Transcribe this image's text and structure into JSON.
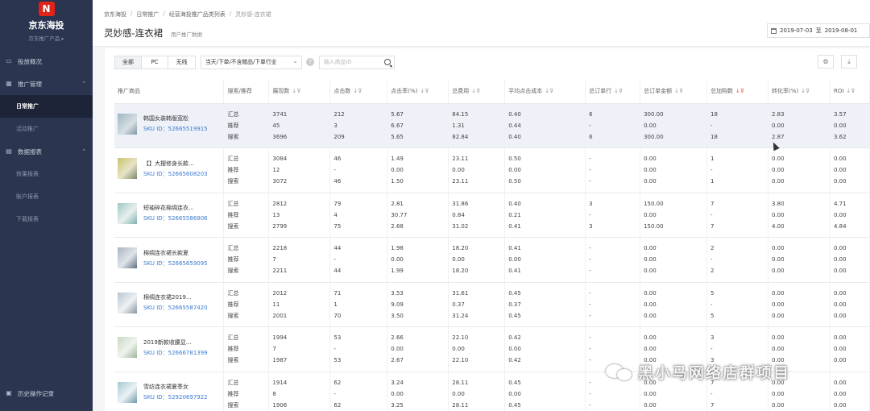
{
  "sidebar": {
    "brand_logo": "N",
    "brand_title": "京东海投",
    "brand_sub": "京东推广产品 ▸",
    "items": [
      {
        "label": "投放概况",
        "icon": "monitor-icon"
      },
      {
        "label": "推广管理",
        "icon": "grid-icon",
        "chevron": "⌃"
      },
      {
        "label": "数据报表",
        "icon": "chart-icon",
        "chevron": "⌃"
      }
    ],
    "sub_promo": [
      "日常推广",
      "活动推广"
    ],
    "sub_reports": [
      "效果报表",
      "账户报表",
      "下载报表"
    ],
    "history": "历史操作记录"
  },
  "header": {
    "breadcrumb": [
      "京东海投",
      "日常推广",
      "经营海投推广品类列表",
      "灵妙感-连衣裙"
    ],
    "title": "灵妙感-连衣裙",
    "subtitle": "用户推广数据",
    "date_start": "2019-07-03",
    "date_sep": "至",
    "date_end": "2019-08-01"
  },
  "toolbar": {
    "tabs": [
      "全部",
      "PC",
      "无线"
    ],
    "active_tab": "全部",
    "select_value": "当天/下单/不含赠品/下单行业",
    "search_placeholder": "输入商品ID",
    "settings_icon": "⚙",
    "download_icon": "⤓"
  },
  "table": {
    "headers": [
      "推广商品",
      "搜索/推荐",
      "展现数",
      "点击数",
      "点击率(%)",
      "总费用",
      "平均点击成本",
      "总订单行",
      "总订单金额",
      "总加购数",
      "转化率(%)",
      "ROI"
    ],
    "rows": [
      {
        "name": "韩国女装韩版宽松",
        "sku": "SKU ID：52665519915",
        "types": [
          "汇总",
          "推荐",
          "搜索"
        ],
        "cols": [
          [
            "3741",
            "45",
            "3696"
          ],
          [
            "212",
            "3",
            "209"
          ],
          [
            "5.67",
            "6.67",
            "5.65"
          ],
          [
            "84.15",
            "1.31",
            "82.84"
          ],
          [
            "0.40",
            "0.44",
            "0.40"
          ],
          [
            "6",
            "-",
            "6"
          ],
          [
            "300.00",
            "0.00",
            "300.00"
          ],
          [
            "18",
            "-",
            "18"
          ],
          [
            "2.83",
            "0.00",
            "2.87"
          ],
          [
            "3.57",
            "0.00",
            "3.62"
          ]
        ]
      },
      {
        "name": "【】大摆修身长款...",
        "sku": "SKU ID：52665608203",
        "types": [
          "汇总",
          "推荐",
          "搜索"
        ],
        "cols": [
          [
            "3084",
            "12",
            "3072"
          ],
          [
            "46",
            "-",
            "46"
          ],
          [
            "1.49",
            "0.00",
            "1.50"
          ],
          [
            "23.11",
            "0.00",
            "23.11"
          ],
          [
            "0.50",
            "0.00",
            "0.50"
          ],
          [
            "-",
            "-",
            "-"
          ],
          [
            "0.00",
            "0.00",
            "0.00"
          ],
          [
            "1",
            "-",
            "1"
          ],
          [
            "0.00",
            "0.00",
            "0.00"
          ],
          [
            "0.00",
            "0.00",
            "0.00"
          ]
        ]
      },
      {
        "name": "短袖碎花棉绸连衣...",
        "sku": "SKU ID：52665586806",
        "types": [
          "汇总",
          "推荐",
          "搜索"
        ],
        "cols": [
          [
            "2812",
            "13",
            "2799"
          ],
          [
            "79",
            "4",
            "75"
          ],
          [
            "2.81",
            "30.77",
            "2.68"
          ],
          [
            "31.86",
            "0.84",
            "31.02"
          ],
          [
            "0.40",
            "0.21",
            "0.41"
          ],
          [
            "3",
            "-",
            "3"
          ],
          [
            "150.00",
            "0.00",
            "150.00"
          ],
          [
            "7",
            "-",
            "7"
          ],
          [
            "3.80",
            "0.00",
            "4.00"
          ],
          [
            "4.71",
            "0.00",
            "4.84"
          ]
        ]
      },
      {
        "name": "棉绸连衣裙长款夏",
        "sku": "SKU ID：52665659095",
        "types": [
          "汇总",
          "推荐",
          "搜索"
        ],
        "cols": [
          [
            "2218",
            "7",
            "2211"
          ],
          [
            "44",
            "-",
            "44"
          ],
          [
            "1.98",
            "0.00",
            "1.99"
          ],
          [
            "18.20",
            "0.00",
            "18.20"
          ],
          [
            "0.41",
            "0.00",
            "0.41"
          ],
          [
            "-",
            "-",
            "-"
          ],
          [
            "0.00",
            "0.00",
            "0.00"
          ],
          [
            "2",
            "-",
            "2"
          ],
          [
            "0.00",
            "0.00",
            "0.00"
          ],
          [
            "0.00",
            "0.00",
            "0.00"
          ]
        ]
      },
      {
        "name": "棉绸连衣裙2019...",
        "sku": "SKU ID：52665587420",
        "types": [
          "汇总",
          "推荐",
          "搜索"
        ],
        "cols": [
          [
            "2012",
            "11",
            "2001"
          ],
          [
            "71",
            "1",
            "70"
          ],
          [
            "3.53",
            "9.09",
            "3.50"
          ],
          [
            "31.61",
            "0.37",
            "31.24"
          ],
          [
            "0.45",
            "0.37",
            "0.45"
          ],
          [
            "-",
            "-",
            "-"
          ],
          [
            "0.00",
            "0.00",
            "0.00"
          ],
          [
            "5",
            "-",
            "5"
          ],
          [
            "0.00",
            "0.00",
            "0.00"
          ],
          [
            "0.00",
            "0.00",
            "0.00"
          ]
        ]
      },
      {
        "name": "2019新款收腰显...",
        "sku": "SKU ID：52666781399",
        "types": [
          "汇总",
          "推荐",
          "搜索"
        ],
        "cols": [
          [
            "1994",
            "7",
            "1987"
          ],
          [
            "53",
            "-",
            "53"
          ],
          [
            "2.66",
            "0.00",
            "2.67"
          ],
          [
            "22.10",
            "0.00",
            "22.10"
          ],
          [
            "0.42",
            "0.00",
            "0.42"
          ],
          [
            "-",
            "-",
            "-"
          ],
          [
            "0.00",
            "0.00",
            "0.00"
          ],
          [
            "3",
            "-",
            "3"
          ],
          [
            "0.00",
            "0.00",
            "0.00"
          ],
          [
            "0.00",
            "0.00",
            "0.00"
          ]
        ]
      },
      {
        "name": "雪纺连衣裙夏季女",
        "sku": "SKU ID：52920697922",
        "types": [
          "汇总",
          "推荐",
          "搜索"
        ],
        "cols": [
          [
            "1914",
            "8",
            "1906"
          ],
          [
            "62",
            "-",
            "62"
          ],
          [
            "3.24",
            "0.00",
            "3.25"
          ],
          [
            "28.11",
            "0.00",
            "28.11"
          ],
          [
            "0.45",
            "0.00",
            "0.45"
          ],
          [
            "-",
            "-",
            "-"
          ],
          [
            "0.00",
            "0.00",
            "0.00"
          ],
          [
            "7",
            "-",
            "7"
          ],
          [
            "0.00",
            "0.00",
            "0.00"
          ],
          [
            "0.00",
            "0.00",
            "0.00"
          ]
        ]
      }
    ]
  },
  "watermark": "黑小马网络店群项目"
}
